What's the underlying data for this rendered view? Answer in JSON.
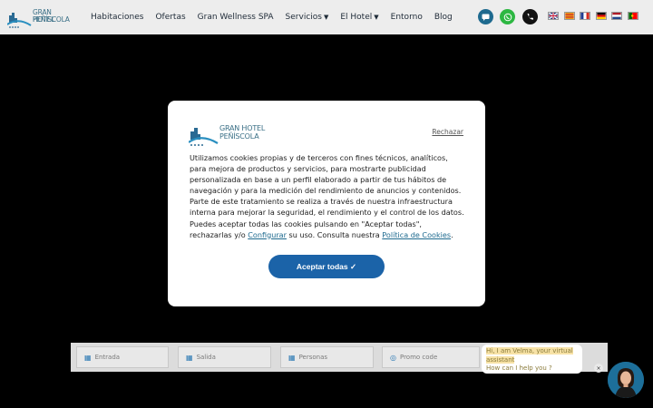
{
  "brand": {
    "line1": "GRAN HOTEL",
    "line2": "PEÑÍSCOLA"
  },
  "nav": [
    {
      "label": "Habitaciones",
      "dropdown": false
    },
    {
      "label": "Ofertas",
      "dropdown": false
    },
    {
      "label": "Gran Wellness SPA",
      "dropdown": false
    },
    {
      "label": "Servicios",
      "dropdown": true
    },
    {
      "label": "El Hotel",
      "dropdown": true
    },
    {
      "label": "Entorno",
      "dropdown": false
    },
    {
      "label": "Blog",
      "dropdown": false
    }
  ],
  "contact": {
    "colors": {
      "message": "#1e6a8f",
      "whatsapp": "#2db742",
      "phone": "#111111"
    }
  },
  "cookie": {
    "reject": "Rechazar",
    "text_main": "Utilizamos cookies propias y de terceros con fines técnicos, analíticos, para mejora de productos y servicios, para mostrarte publicidad personalizada en base a un perfil elaborado a partir de tus hábitos de navegación y para la medición del rendimiento de anuncios y contenidos. Parte de este tratamiento se realiza a través de nuestra infraestructura interna para mejorar la seguridad, el rendimiento y el control de los datos. Puedes aceptar todas las cookies pulsando en \"Aceptar todas\", rechazarlas y/o ",
    "link_config": "Configurar",
    "text_mid": " su uso. Consulta nuestra ",
    "link_policy": "Política de Cookies",
    "text_end": ".",
    "accept": "Aceptar todas ✓"
  },
  "booking": {
    "entrada": "Entrada",
    "salida": "Salida",
    "personas": "Personas",
    "promo": "Promo code"
  },
  "chat": {
    "line1": "Hi, I am Velma, your virtual",
    "line2": "assistant",
    "line3": "How can I help you ?",
    "close": "×"
  },
  "colors": {
    "accent": "#1b63a8",
    "brand": "#3a6f86",
    "header_bg": "#ededed"
  }
}
